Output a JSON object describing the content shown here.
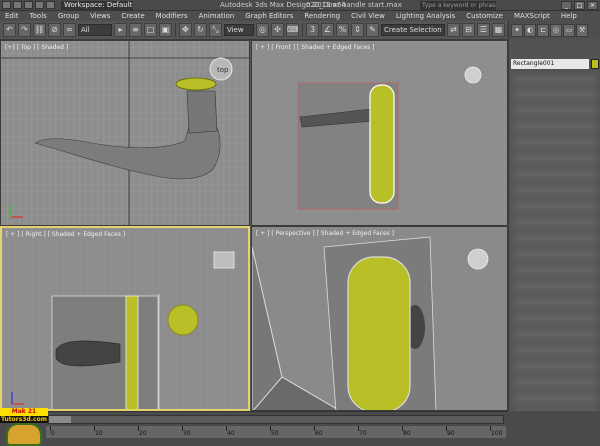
{
  "window": {
    "app_title": "Autodesk 3ds Max Design 2013 x64",
    "file_title": "020_Door handle start.max",
    "workspace": "Workspace: Default",
    "search_placeholder": "Type a keyword or phrase"
  },
  "menu": [
    "Edit",
    "Tools",
    "Group",
    "Views",
    "Create",
    "Modifiers",
    "Animation",
    "Graph Editors",
    "Rendering",
    "Civil View",
    "Lighting Analysis",
    "Customize",
    "MAXScript",
    "Help"
  ],
  "toolbar": {
    "selection_filter": "All",
    "reference_coord": "View",
    "selection_set": "Create Selection Se"
  },
  "viewports": {
    "top": "[+] [ Top ] [ Shaded ]",
    "front": "[ + ] [ Front ] [ Shaded + Edged Faces ]",
    "right": "[ + ] [ Right ] [ Shaded + Edged Faces ]",
    "perspective": "[ + ] [ Perspective ] [ Shaded + Edged Faces ]"
  },
  "command_panel": {
    "object_name": "Rectangle001",
    "object_color": "#b6c21a"
  },
  "timeline": {
    "ticks": [
      "0",
      "10",
      "20",
      "30",
      "40",
      "50",
      "60",
      "70",
      "80",
      "90",
      "100"
    ]
  },
  "branding": {
    "line1": "Mak 21 Training",
    "line2": "Tutors3d.com"
  },
  "colors": {
    "handle_yellow": "#b9bf27",
    "active_border": "#e3d36a",
    "viewport_bg": "#8d8d8d"
  }
}
